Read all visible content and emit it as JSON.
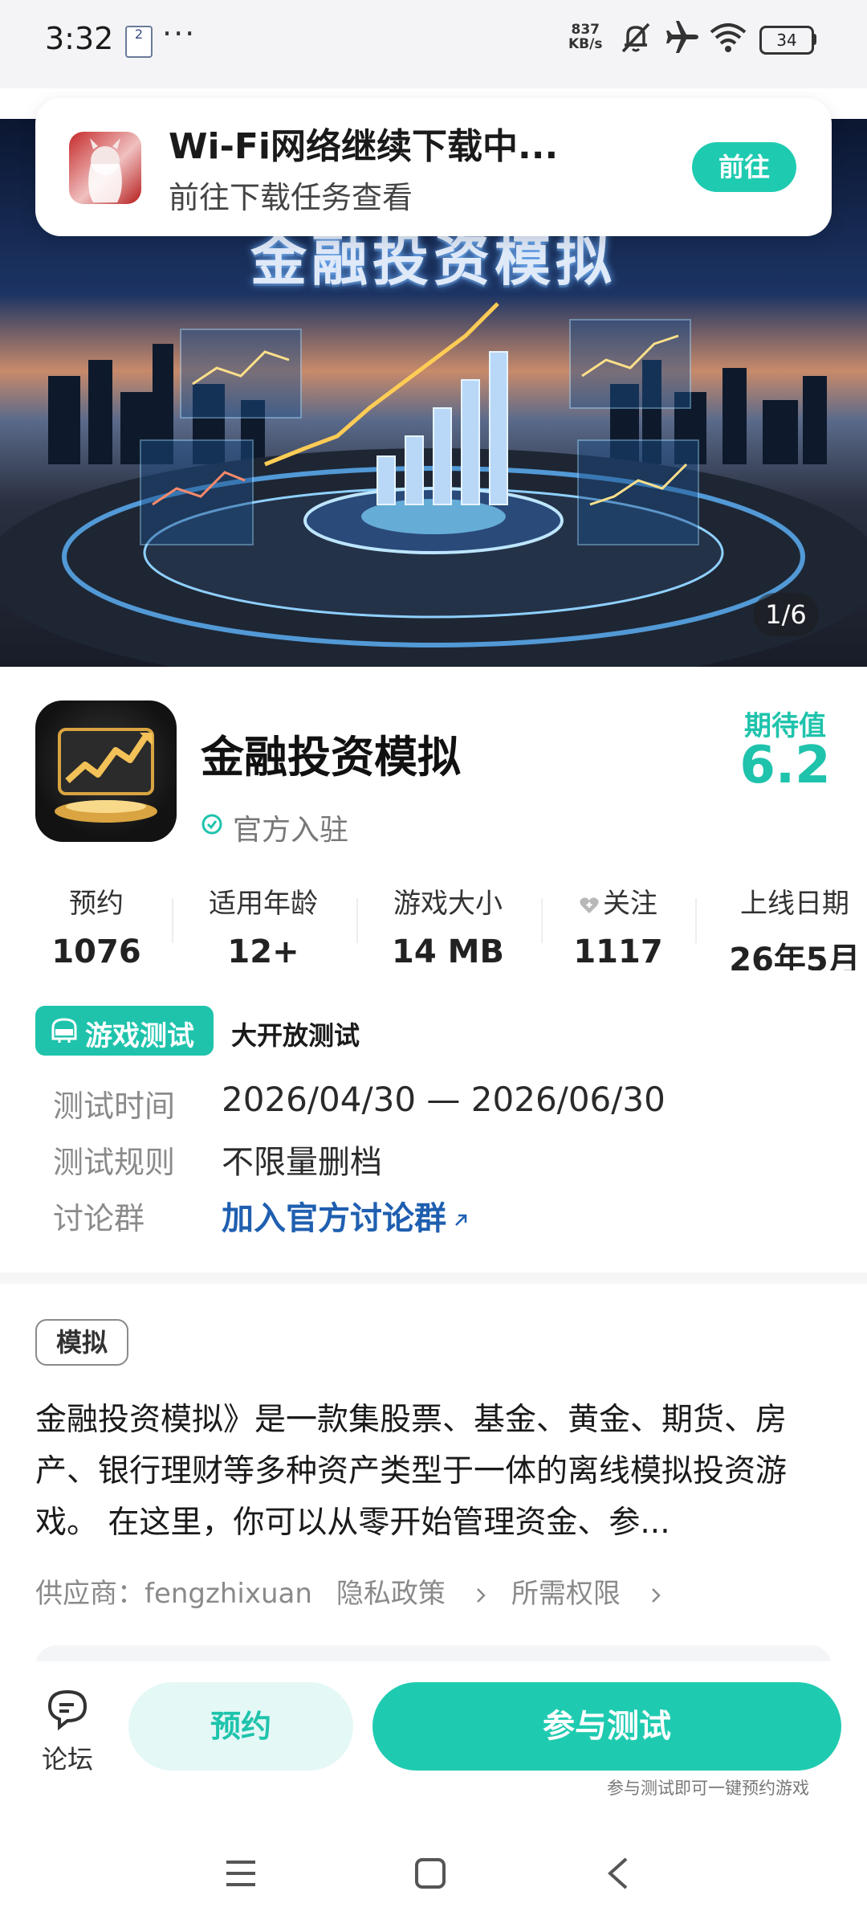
{
  "status_bar": {
    "time": "3:32",
    "sim_badge": "2",
    "more": "···",
    "speed_value": "837",
    "speed_unit": "KB/s",
    "battery": "34"
  },
  "notification": {
    "title": "Wi-Fi网络继续下载中...",
    "subtitle": "前往下载任务查看",
    "go_label": "前往"
  },
  "banner": {
    "title": "金融投资模拟",
    "counter": "1/6"
  },
  "app": {
    "name": "金融投资模拟",
    "verified_label": "官方入驻",
    "score_label": "期待值",
    "score_value": "6.2"
  },
  "stats": [
    {
      "label": "预约",
      "value": "1076"
    },
    {
      "label": "适用年龄",
      "value": "12+"
    },
    {
      "label": "游戏大小",
      "value": "14 MB"
    },
    {
      "label": "关注",
      "value": "1117"
    },
    {
      "label": "上线日期",
      "value": "26年5月"
    }
  ],
  "test": {
    "badge_label": "游戏测试",
    "type": "大开放测试",
    "time_label": "测试时间",
    "time_value": "2026/04/30 — 2026/06/30",
    "rule_label": "测试规则",
    "rule_value": "不限量删档",
    "group_label": "讨论群",
    "group_link": "加入官方讨论群"
  },
  "description": {
    "tag": "模拟",
    "text": "金融投资模拟》是一款集股票、基金、黄金、期货、房产、银行理财等多种资产类型于一体的离线模拟投资游戏。 在这里，你可以从零开始管理资金、参...",
    "supplier": "供应商：fengzhixuan",
    "privacy": "隐私政策",
    "permissions": "所需权限"
  },
  "actions": {
    "forum_label": "论坛",
    "reserve_label": "预约",
    "join_label": "参与测试",
    "join_hint": "参与测试即可一键预约游戏"
  },
  "colors": {
    "accent": "#1fcbb0",
    "link": "#1f5fb0"
  }
}
